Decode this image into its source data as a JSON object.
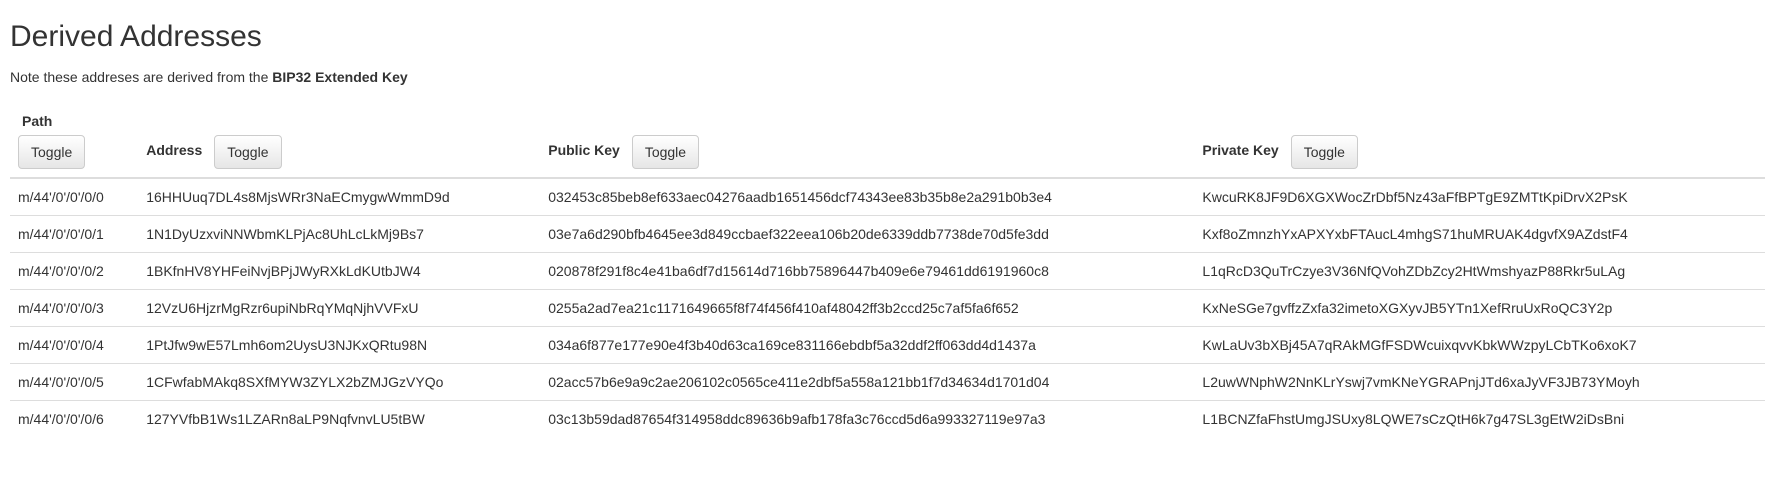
{
  "heading": "Derived Addresses",
  "note_prefix": "Note these addreses are derived from the ",
  "note_bold": "BIP32 Extended Key",
  "columns": {
    "path": "Path",
    "address": "Address",
    "public_key": "Public Key",
    "private_key": "Private Key"
  },
  "toggle_label": "Toggle",
  "rows": [
    {
      "path": "m/44'/0'/0'/0/0",
      "address": "16HHUuq7DL4s8MjsWRr3NaECmygwWmmD9d",
      "public_key": "032453c85beb8ef633aec04276aadb1651456dcf74343ee83b35b8e2a291b0b3e4",
      "private_key": "KwcuRK8JF9D6XGXWocZrDbf5Nz43aFfBPTgE9ZMTtKpiDrvX2PsK"
    },
    {
      "path": "m/44'/0'/0'/0/1",
      "address": "1N1DyUzxviNNWbmKLPjAc8UhLcLkMj9Bs7",
      "public_key": "03e7a6d290bfb4645ee3d849ccbaef322eea106b20de6339ddb7738de70d5fe3dd",
      "private_key": "Kxf8oZmnzhYxAPXYxbFTAucL4mhgS71huMRUAK4dgvfX9AZdstF4"
    },
    {
      "path": "m/44'/0'/0'/0/2",
      "address": "1BKfnHV8YHFeiNvjBPjJWyRXkLdKUtbJW4",
      "public_key": "020878f291f8c4e41ba6df7d15614d716bb75896447b409e6e79461dd6191960c8",
      "private_key": "L1qRcD3QuTrCzye3V36NfQVohZDbZcy2HtWmshyazP88Rkr5uLAg"
    },
    {
      "path": "m/44'/0'/0'/0/3",
      "address": "12VzU6HjzrMgRzr6upiNbRqYMqNjhVVFxU",
      "public_key": "0255a2ad7ea21c1171649665f8f74f456f410af48042ff3b2ccd25c7af5fa6f652",
      "private_key": "KxNeSGe7gvffzZxfa32imetoXGXyvJB5YTn1XefRruUxRoQC3Y2p"
    },
    {
      "path": "m/44'/0'/0'/0/4",
      "address": "1PtJfw9wE57Lmh6om2UysU3NJKxQRtu98N",
      "public_key": "034a6f877e177e90e4f3b40d63ca169ce831166ebdbf5a32ddf2ff063dd4d1437a",
      "private_key": "KwLaUv3bXBj45A7qRAkMGfFSDWcuixqvvKbkWWzpyLCbTKo6xoK7"
    },
    {
      "path": "m/44'/0'/0'/0/5",
      "address": "1CFwfabMAkq8SXfMYW3ZYLX2bZMJGzVYQo",
      "public_key": "02acc57b6e9a9c2ae206102c0565ce411e2dbf5a558a121bb1f7d34634d1701d04",
      "private_key": "L2uwWNphW2NnKLrYswj7vmKNeYGRAPnjJTd6xaJyVF3JB73YMoyh"
    },
    {
      "path": "m/44'/0'/0'/0/6",
      "address": "127YVfbB1Ws1LZARn8aLP9NqfvnvLU5tBW",
      "public_key": "03c13b59dad87654f314958ddc89636b9afb178fa3c76ccd5d6a993327119e97a3",
      "private_key": "L1BCNZfaFhstUmgJSUxy8LQWE7sCzQtH6k7g47SL3gEtW2iDsBni"
    }
  ]
}
